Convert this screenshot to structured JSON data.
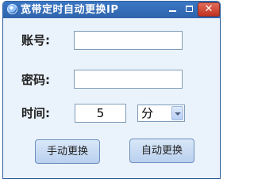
{
  "window": {
    "title": "宽带定时自动更换IP",
    "close_glyph": "✕"
  },
  "form": {
    "account_label": "账号:",
    "account_value": "",
    "password_label": "密码:",
    "password_value": "",
    "time_label": "时间:",
    "time_value": "5",
    "unit_selected": "分"
  },
  "buttons": {
    "manual_label": "手动更换",
    "auto_label": "自动更换"
  }
}
